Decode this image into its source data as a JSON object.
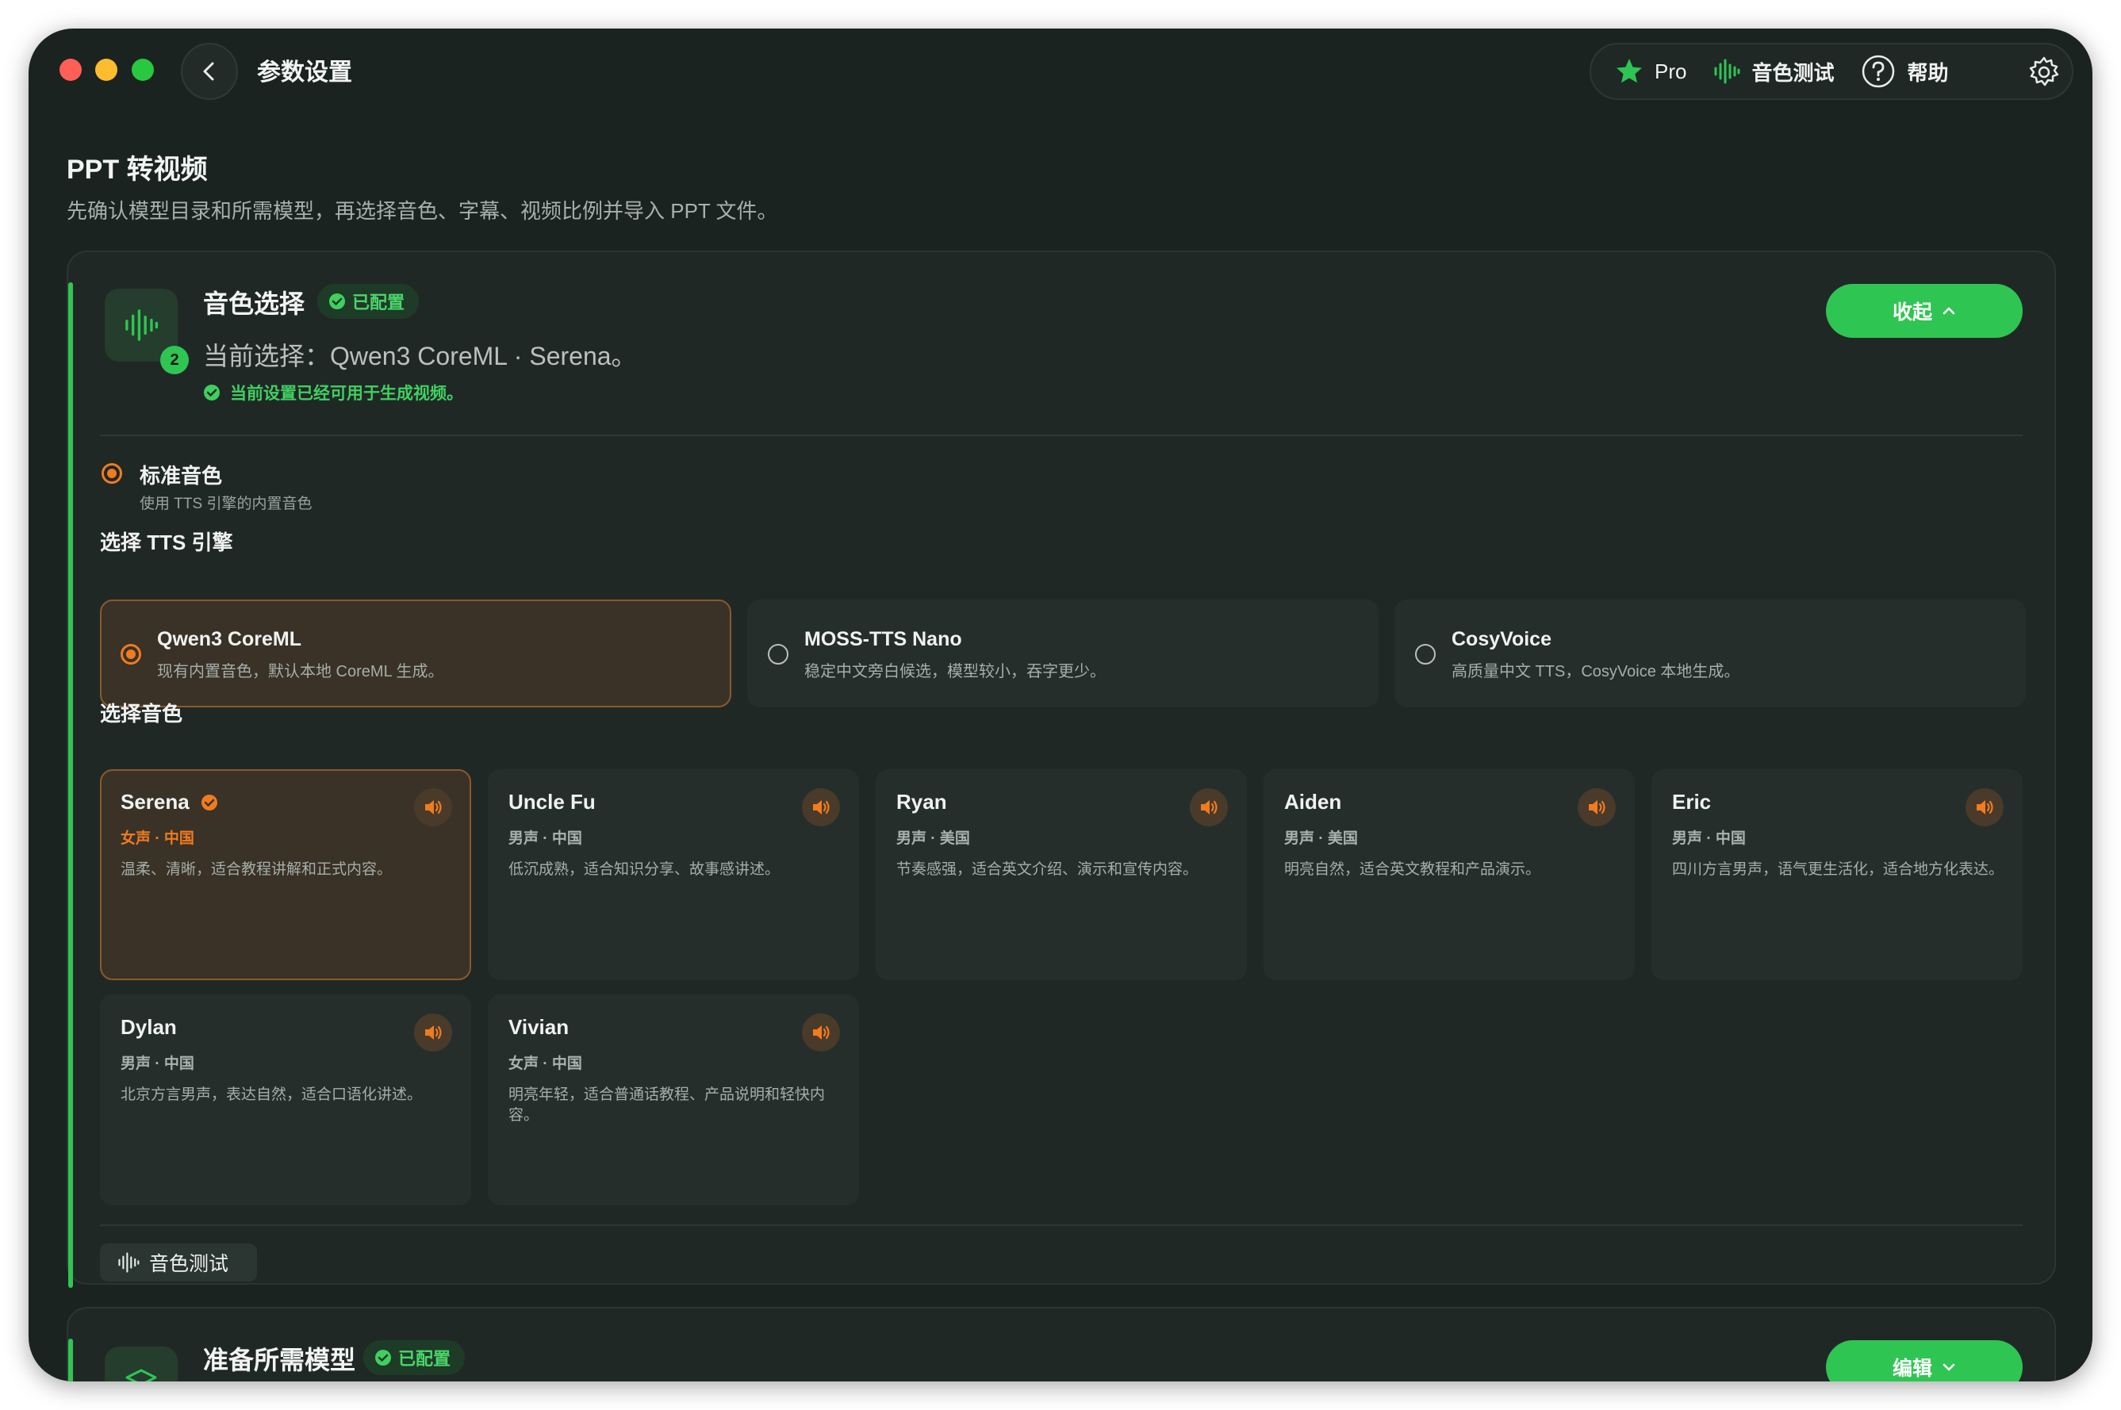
{
  "window": {
    "title": "参数设置"
  },
  "toolbar": {
    "pro_label": "Pro",
    "voice_test_label": "音色测试",
    "help_label": "帮助"
  },
  "page": {
    "title": "PPT 转视频",
    "subtitle": "先确认模型目录和所需模型，再选择音色、字幕、视频比例并导入 PPT 文件。"
  },
  "voice_section": {
    "step": "2",
    "title": "音色选择",
    "status_badge": "已配置",
    "current_selection": "当前选择：Qwen3 CoreML · Serena。",
    "ready_text": "当前设置已经可用于生成视频。",
    "collapse_label": "收起",
    "standard_voice": {
      "label": "标准音色",
      "sub": "使用 TTS 引擎的内置音色"
    },
    "engine_heading": "选择 TTS 引擎",
    "engines": [
      {
        "name": "Qwen3 CoreML",
        "desc": "现有内置音色，默认本地 CoreML 生成。",
        "selected": true
      },
      {
        "name": "MOSS-TTS Nano",
        "desc": "稳定中文旁白候选，模型较小，吞字更少。",
        "selected": false
      },
      {
        "name": "CosyVoice",
        "desc": "高质量中文 TTS，CosyVoice 本地生成。",
        "selected": false
      }
    ],
    "voice_heading": "选择音色",
    "voices": [
      {
        "name": "Serena",
        "meta": "女声 · 中国",
        "desc": "温柔、清晰，适合教程讲解和正式内容。",
        "selected": true
      },
      {
        "name": "Uncle Fu",
        "meta": "男声 · 中国",
        "desc": "低沉成熟，适合知识分享、故事感讲述。",
        "selected": false
      },
      {
        "name": "Ryan",
        "meta": "男声 · 美国",
        "desc": "节奏感强，适合英文介绍、演示和宣传内容。",
        "selected": false
      },
      {
        "name": "Aiden",
        "meta": "男声 · 美国",
        "desc": "明亮自然，适合英文教程和产品演示。",
        "selected": false
      },
      {
        "name": "Eric",
        "meta": "男声 · 中国",
        "desc": "四川方言男声，语气更生活化，适合地方化表达。",
        "selected": false
      },
      {
        "name": "Dylan",
        "meta": "男声 · 中国",
        "desc": "北京方言男声，表达自然，适合口语化讲述。",
        "selected": false
      },
      {
        "name": "Vivian",
        "meta": "女声 · 中国",
        "desc": "明亮年轻，适合普通话教程、产品说明和轻快内容。",
        "selected": false
      }
    ],
    "test_button_label": "音色测试"
  },
  "models_section": {
    "title": "准备所需模型",
    "status_badge": "已配置",
    "edit_label": "编辑"
  },
  "colors": {
    "accent_green": "#2fc552",
    "accent_orange": "#f07b20",
    "background": "#1b2320"
  }
}
